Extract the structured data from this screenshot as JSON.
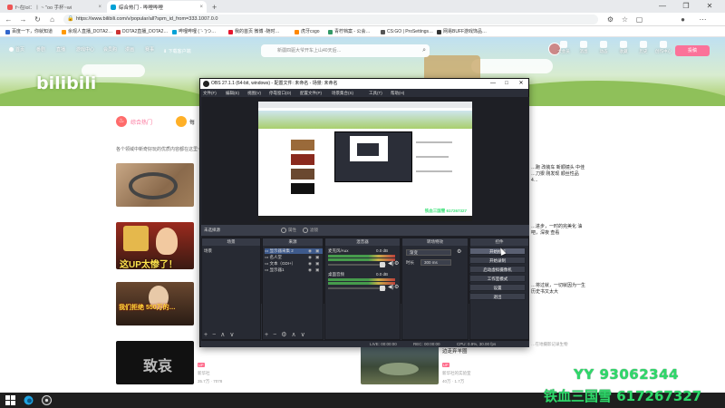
{
  "browser": {
    "tabs": [
      {
        "label": "f~在lol：丨 ~ \"oo 手杯~wi",
        "close": "×"
      },
      {
        "label": "综合热门 - 哔哩哔哩",
        "close": "×"
      }
    ],
    "new_tab": "+",
    "window_controls": [
      "—",
      "❐",
      "✕"
    ],
    "url": "https://www.bilibili.com/v/popular/all?spm_id_from=333.1007.0.0",
    "bookmarks": [
      "百度一下，你就知道",
      "余观人直播_DOTA2…",
      "DOTA2直播_DOTA2…",
      "哔哩哔哩 ( '- ')つ…",
      "我的首页 微博 -随时…",
      "虎牙csgo",
      "青柠档案 - 公会…",
      "CS:GO | ProSettings…",
      "网易BUFF游戏饰品…"
    ]
  },
  "bili": {
    "nav": [
      "首页",
      "番剧",
      "直播",
      "游戏中心",
      "会员购",
      "漫画",
      "赛事",
      "下载客户端"
    ],
    "search_placeholder": "新疆四驱大爷开车上山40天后…",
    "right": [
      "大会员",
      "消息",
      "动态",
      "收藏",
      "历史",
      "创作中心"
    ],
    "upload": "投稿",
    "logo": "bilibili",
    "hot_tab": "综合热门",
    "tab2": "每",
    "subtitle": "各个领域中新奇好玩的优质内容都在这里~",
    "videos_right": [
      {
        "title": "…跑 改装车 新顺镜头 中佳",
        "sub": "…刀狠 刚发现 顺丝性品 4…"
      },
      {
        "title": "…进步，一时的完美化 油吧，深夜 查看",
        "sub": ""
      },
      {
        "title": "…将过就，一切就因为一生 历史书又太大",
        "sub": ""
      },
      {
        "title": "边走弃羊圈",
        "sub": "…在地摄影记录生物"
      }
    ],
    "bottom_left": {
      "tag": "UP",
      "author": "新华社",
      "stats": "35.7万 · 7078",
      "caption": "致哀"
    },
    "bottom_right": {
      "tag": "UP",
      "author": "新华社的实验室",
      "stats": "40万 · 1.7万"
    },
    "thumb_captions": [
      "",
      "这UP太惨了！",
      "我们拒绝 550万的…",
      "致哀"
    ]
  },
  "obs": {
    "title": "OBS 27.1.1 (64-bit, windows) - 配置文件: 未命名 - 场景: 未命名",
    "menu": [
      "文件(F)",
      "编辑(E)",
      "视图(V)",
      "停靠窗口(D)",
      "配置文件(P)",
      "场景集合(S)",
      "工具(T)",
      "帮助(H)"
    ],
    "scenebar_label": "未选择源",
    "scenebar_items": [
      "属性",
      "滤镜"
    ],
    "docks": {
      "scenes": "场景",
      "sources": "来源",
      "mixer": "混音器",
      "transitions": "转场特效",
      "controls": "控件"
    },
    "scene_items": [
      "场景"
    ],
    "source_items": [
      "显示器采集 2",
      "名人堂",
      "文本（GDI+）",
      "显示器1"
    ],
    "mixer_items": [
      {
        "name": "麦克风/Aux",
        "db": "0.0 dB"
      },
      {
        "name": "桌面音频",
        "db": "0.0 dB"
      }
    ],
    "transition_select": "渐变",
    "duration_label": "时长",
    "duration_value": "300 ms",
    "controls": [
      "开始推流",
      "开始录制",
      "启动虚拟摄像机",
      "工作室模式",
      "设置",
      "退出"
    ],
    "status": [
      "LIVE: 00:00:00",
      "REC: 00:00:00",
      "CPU: 0.9%, 30.00 fps"
    ],
    "nested_overlay": "铁血三国雪 617267327"
  },
  "overlay": {
    "yy": "YY 93062344",
    "tiexue": "铁血三国雪 617267327"
  },
  "colors": {
    "bili_pink": "#fb7299",
    "obs_bg": "#2b2e38",
    "overlay_green": "#2fd86a",
    "taskbar": "#1f1f1f"
  }
}
